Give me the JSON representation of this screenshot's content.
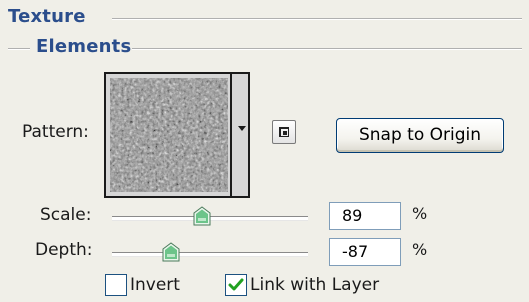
{
  "section": {
    "title": "Texture"
  },
  "subsection": {
    "title": "Elements"
  },
  "pattern": {
    "label": "Pattern:",
    "swatch_icon": "granite-texture-swatch",
    "dropdown_icon": "triangle-down-icon"
  },
  "new_preset_button": {
    "icon": "new-preset-icon"
  },
  "snap_button": {
    "label": "Snap to Origin"
  },
  "scale": {
    "label": "Scale:",
    "value": "89",
    "unit": "%",
    "slider_fraction": 0.46
  },
  "depth": {
    "label": "Depth:",
    "value": "-87",
    "unit": "%",
    "slider_fraction": 0.3
  },
  "invert": {
    "label": "Invert",
    "checked": false
  },
  "link": {
    "label": "Link with Layer",
    "checked": true
  },
  "colors": {
    "header": "#2b4e8c",
    "background": "#f0efe8",
    "check": "#21a121",
    "thumb": "#3aa35a"
  }
}
